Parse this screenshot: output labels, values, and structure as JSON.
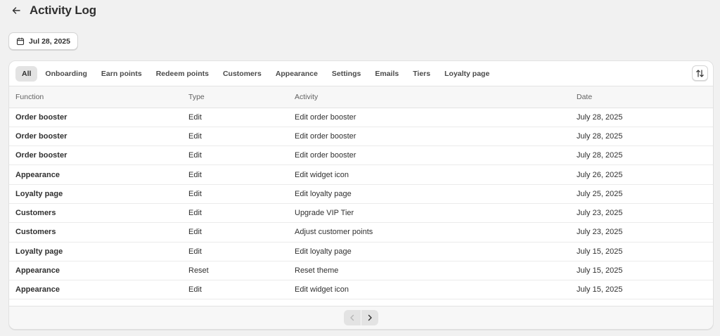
{
  "header": {
    "title": "Activity Log",
    "back_icon": "arrow-left-icon"
  },
  "date_filter": {
    "label": "Jul 28, 2025",
    "icon": "calendar-icon"
  },
  "tabs": [
    {
      "label": "All",
      "active": true
    },
    {
      "label": "Onboarding"
    },
    {
      "label": "Earn points"
    },
    {
      "label": "Redeem points"
    },
    {
      "label": "Customers"
    },
    {
      "label": "Appearance"
    },
    {
      "label": "Settings"
    },
    {
      "label": "Emails"
    },
    {
      "label": "Tiers"
    },
    {
      "label": "Loyalty page"
    }
  ],
  "table": {
    "columns": [
      "Function",
      "Type",
      "Activity",
      "Date"
    ],
    "rows": [
      [
        "Order booster",
        "Edit",
        "Edit order booster",
        "July 28, 2025"
      ],
      [
        "Order booster",
        "Edit",
        "Edit order booster",
        "July 28, 2025"
      ],
      [
        "Order booster",
        "Edit",
        "Edit order booster",
        "July 28, 2025"
      ],
      [
        "Appearance",
        "Edit",
        "Edit widget icon",
        "July 26, 2025"
      ],
      [
        "Loyalty page",
        "Edit",
        "Edit loyalty page",
        "July 25, 2025"
      ],
      [
        "Customers",
        "Edit",
        "Upgrade VIP Tier",
        "July 23, 2025"
      ],
      [
        "Customers",
        "Edit",
        "Adjust customer points",
        "July 23, 2025"
      ],
      [
        "Loyalty page",
        "Edit",
        "Edit loyalty page",
        "July 15, 2025"
      ],
      [
        "Appearance",
        "Reset",
        "Reset theme",
        "July 15, 2025"
      ],
      [
        "Appearance",
        "Edit",
        "Edit widget icon",
        "July 15, 2025"
      ]
    ]
  },
  "pagination": {
    "prev_icon": "chevron-left-icon",
    "next_icon": "chevron-right-icon",
    "prev_disabled": true
  }
}
